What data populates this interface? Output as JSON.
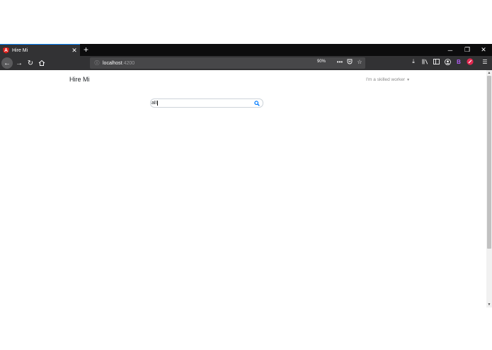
{
  "browser": {
    "tab": {
      "title": "Hire Mi",
      "favicon": "angular-logo-icon",
      "favicon_letter": "A"
    },
    "window_controls": {
      "minimize": "─",
      "restore": "❐",
      "close": "✕"
    },
    "url": {
      "host": "localhost",
      "port": ":4200"
    },
    "zoom": "90%",
    "colors": {
      "tabbar_bg": "#0c0c0d",
      "toolbar_bg": "#323234",
      "accent": "#0a84ff"
    }
  },
  "page": {
    "brand": "Hire Mi",
    "role_dropdown": {
      "label": "I'm a skilled worker"
    },
    "search": {
      "value": "all",
      "placeholder": "",
      "button_icon": "search-icon",
      "icon_color": "#007bff"
    }
  }
}
